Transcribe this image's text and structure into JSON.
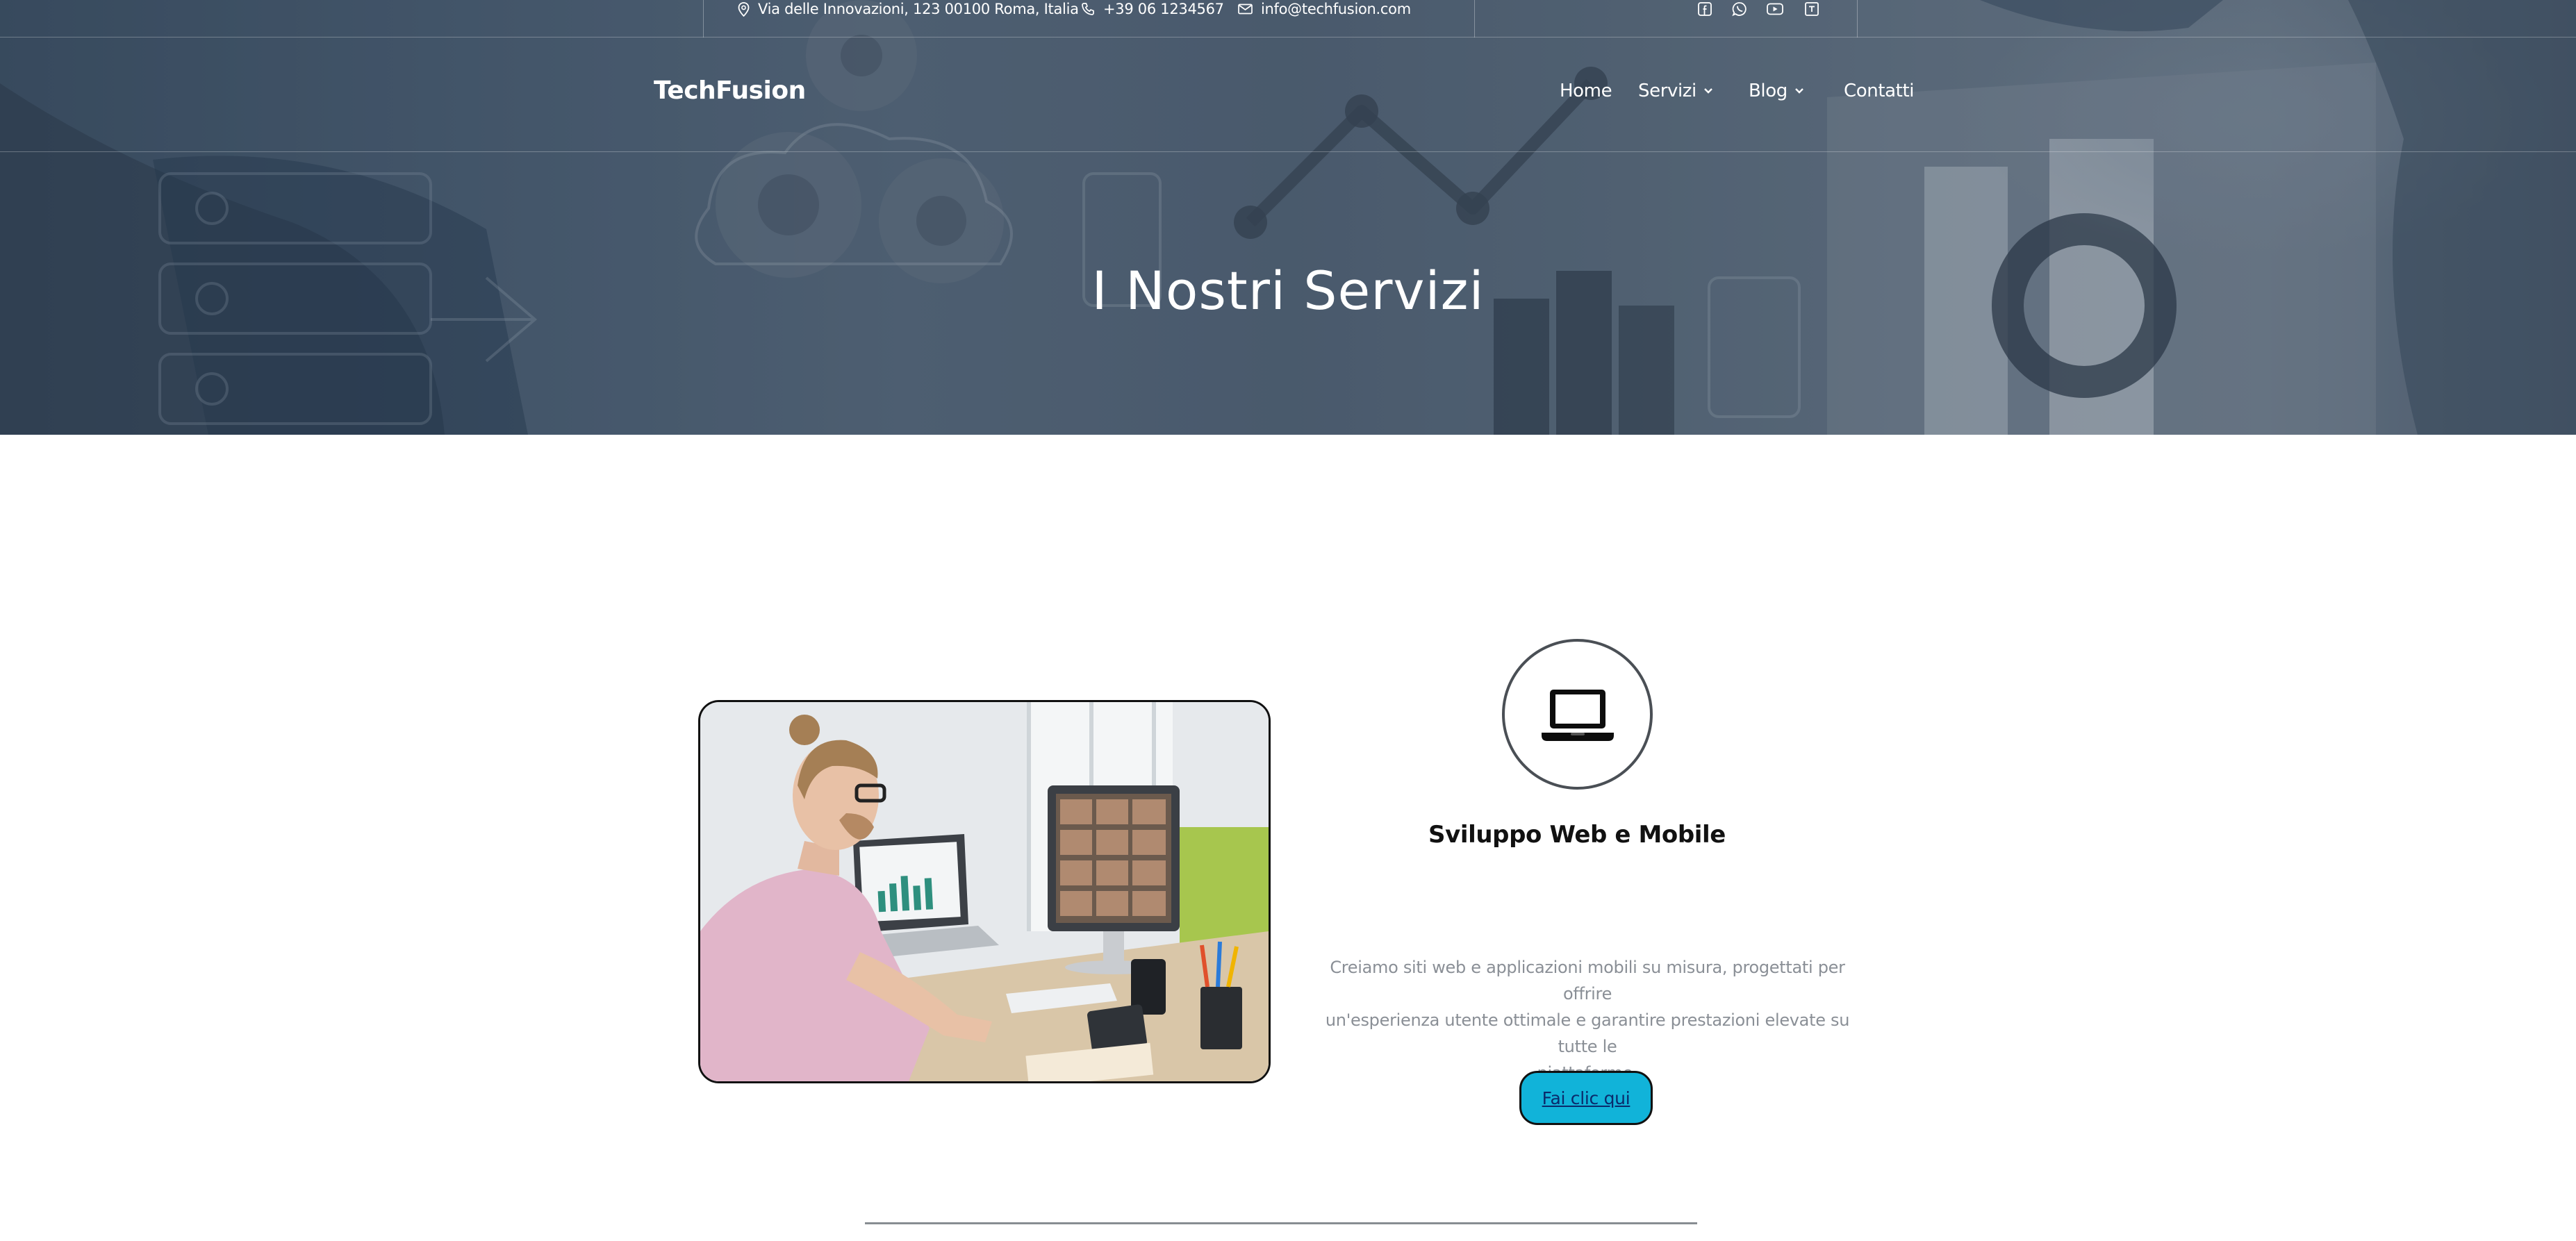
{
  "topbar": {
    "address": "Via delle Innovazioni, 123 00100 Roma, Italia",
    "phone": "+39 06 1234567",
    "email": "info@techfusion.com",
    "social_icons": [
      "facebook-icon",
      "whatsapp-icon",
      "youtube-icon",
      "tripadvisor-icon"
    ]
  },
  "header": {
    "logo": "TechFusion",
    "nav": [
      {
        "label": "Home",
        "has_dropdown": false
      },
      {
        "label": "Servizi",
        "has_dropdown": true
      },
      {
        "label": "Blog",
        "has_dropdown": true
      },
      {
        "label": "Contatti",
        "has_dropdown": false
      }
    ]
  },
  "hero": {
    "title": "I Nostri Servizi"
  },
  "service": {
    "icon": "laptop-icon",
    "title": "Sviluppo Web e Mobile",
    "description_lines": [
      "Creiamo siti web e applicazioni mobili su misura, progettati per offrire",
      "un'esperienza utente ottimale e garantire prestazioni elevate su tutte le",
      "piattaforme."
    ],
    "button_label": "Fai clic qui"
  },
  "colors": {
    "button_bg": "#11b3d9",
    "button_text": "#0a2a6b",
    "description_text": "#8a8f96",
    "hero_overlay": "#4d6176"
  }
}
